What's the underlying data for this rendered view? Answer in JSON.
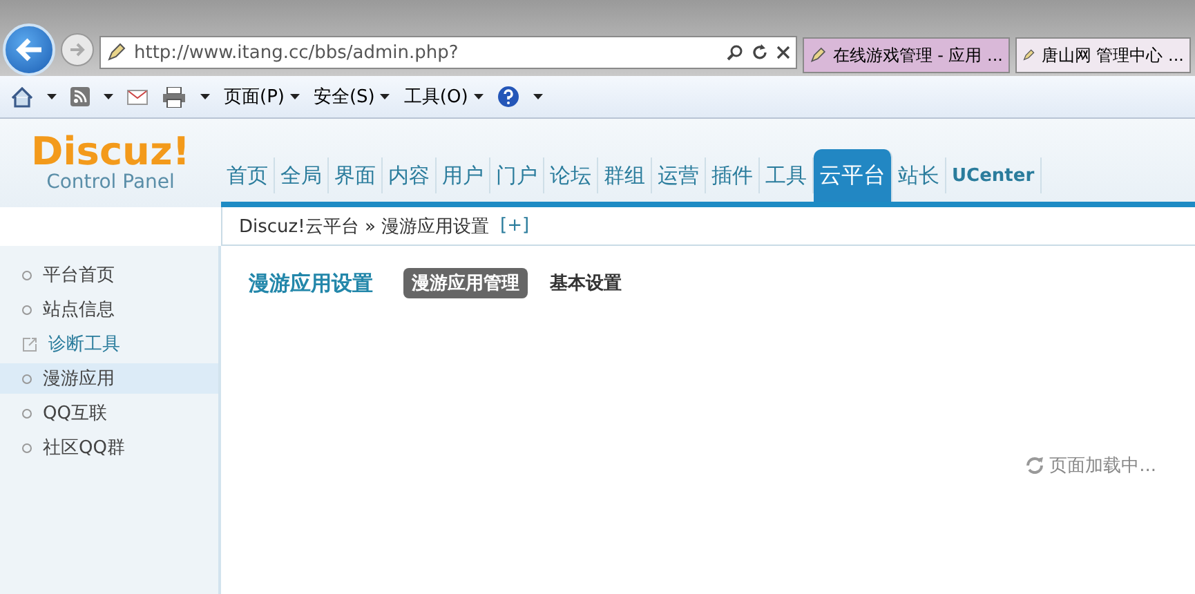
{
  "browser": {
    "address": "http://www.itang.cc/bbs/admin.php?",
    "tabs": [
      {
        "label": "在线游戏管理 - 应用 ...",
        "selected": false
      },
      {
        "label": "唐山网 管理中心 ...",
        "selected": true
      }
    ],
    "toolbar": [
      "页面(P)",
      "安全(S)",
      "工具(O)"
    ]
  },
  "logo": {
    "name": "Discuz!",
    "subtitle": "Control Panel"
  },
  "nav": [
    {
      "label": "首页",
      "selected": false
    },
    {
      "label": "全局",
      "selected": false
    },
    {
      "label": "界面",
      "selected": false
    },
    {
      "label": "内容",
      "selected": false
    },
    {
      "label": "用户",
      "selected": false
    },
    {
      "label": "门户",
      "selected": false
    },
    {
      "label": "论坛",
      "selected": false
    },
    {
      "label": "群组",
      "selected": false
    },
    {
      "label": "运营",
      "selected": false
    },
    {
      "label": "插件",
      "selected": false
    },
    {
      "label": "工具",
      "selected": false
    },
    {
      "label": "云平台",
      "selected": true
    },
    {
      "label": "站长",
      "selected": false
    },
    {
      "label": "UCenter",
      "selected": false
    }
  ],
  "breadcrumb": {
    "path": "Discuz!云平台 » 漫游应用设置",
    "add": "[+]"
  },
  "sidebar": [
    {
      "label": "平台首页",
      "kind": "link",
      "selected": false
    },
    {
      "label": "站点信息",
      "kind": "link",
      "selected": false
    },
    {
      "label": "诊断工具",
      "kind": "external",
      "selected": false
    },
    {
      "label": "漫游应用",
      "kind": "link",
      "selected": true
    },
    {
      "label": "QQ互联",
      "kind": "link",
      "selected": false
    },
    {
      "label": "社区QQ群",
      "kind": "link",
      "selected": false
    }
  ],
  "content": {
    "title": "漫游应用设置",
    "tabs": [
      {
        "label": "漫游应用管理",
        "selected": true
      },
      {
        "label": "基本设置",
        "selected": false
      }
    ],
    "loading": "页面加载中..."
  }
}
